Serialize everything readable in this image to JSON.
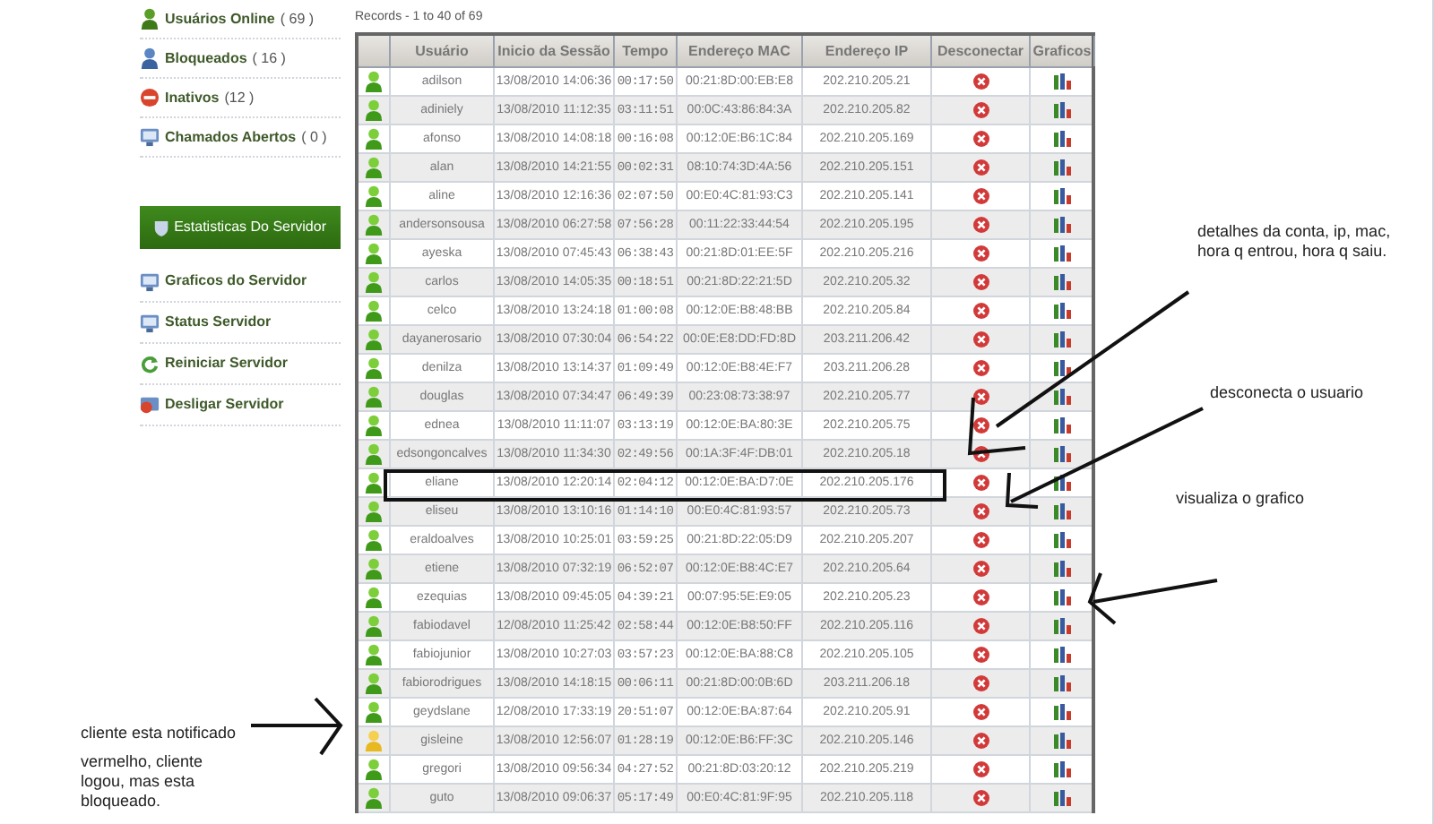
{
  "records": "Records - 1 to 40 of 69",
  "sidebar": {
    "items": [
      {
        "label": "Usuários Online",
        "count": "( 69 )",
        "kind": "online"
      },
      {
        "label": "Bloqueados",
        "count": "( 16 )",
        "kind": "blocked"
      },
      {
        "label": "Inativos",
        "count": "(12 )",
        "kind": "inactive"
      },
      {
        "label": "Chamados Abertos",
        "count": "( 0 )",
        "kind": "tickets"
      }
    ]
  },
  "server_panel": {
    "title": "Estatisticas Do Servidor",
    "items": [
      {
        "label": "Graficos do Servidor",
        "kind": "server"
      },
      {
        "label": "Status Servidor",
        "kind": "server"
      },
      {
        "label": "Reiniciar Servidor",
        "kind": "restart"
      },
      {
        "label": "Desligar Servidor",
        "kind": "shutdown"
      }
    ]
  },
  "table": {
    "columns": [
      "Usuário",
      "Inicio da Sessão",
      "Tempo",
      "Endereço MAC",
      "Endereço IP",
      "Desconectar",
      "Graficos"
    ],
    "rows": [
      {
        "kind": "online",
        "user": "adilson",
        "start": "13/08/2010 14:06:36",
        "time": "00:17:50",
        "mac": "00:21:8D:00:EB:E8",
        "ip": "202.210.205.21"
      },
      {
        "kind": "online",
        "user": "adiniely",
        "start": "13/08/2010 11:12:35",
        "time": "03:11:51",
        "mac": "00:0C:43:86:84:3A",
        "ip": "202.210.205.82"
      },
      {
        "kind": "online",
        "user": "afonso",
        "start": "13/08/2010 14:08:18",
        "time": "00:16:08",
        "mac": "00:12:0E:B6:1C:84",
        "ip": "202.210.205.169"
      },
      {
        "kind": "online",
        "user": "alan",
        "start": "13/08/2010 14:21:55",
        "time": "00:02:31",
        "mac": "08:10:74:3D:4A:56",
        "ip": "202.210.205.151"
      },
      {
        "kind": "online",
        "user": "aline",
        "start": "13/08/2010 12:16:36",
        "time": "02:07:50",
        "mac": "00:E0:4C:81:93:C3",
        "ip": "202.210.205.141"
      },
      {
        "kind": "online",
        "user": "andersonsousa",
        "start": "13/08/2010 06:27:58",
        "time": "07:56:28",
        "mac": "00:11:22:33:44:54",
        "ip": "202.210.205.195"
      },
      {
        "kind": "online",
        "user": "ayeska",
        "start": "13/08/2010 07:45:43",
        "time": "06:38:43",
        "mac": "00:21:8D:01:EE:5F",
        "ip": "202.210.205.216"
      },
      {
        "kind": "online",
        "user": "carlos",
        "start": "13/08/2010 14:05:35",
        "time": "00:18:51",
        "mac": "00:21:8D:22:21:5D",
        "ip": "202.210.205.32"
      },
      {
        "kind": "online",
        "user": "celco",
        "start": "13/08/2010 13:24:18",
        "time": "01:00:08",
        "mac": "00:12:0E:B8:48:BB",
        "ip": "202.210.205.84"
      },
      {
        "kind": "online",
        "user": "dayanerosario",
        "start": "13/08/2010 07:30:04",
        "time": "06:54:22",
        "mac": "00:0E:E8:DD:FD:8D",
        "ip": "203.211.206.42"
      },
      {
        "kind": "online",
        "user": "denilza",
        "start": "13/08/2010 13:14:37",
        "time": "01:09:49",
        "mac": "00:12:0E:B8:4E:F7",
        "ip": "203.211.206.28"
      },
      {
        "kind": "online",
        "user": "douglas",
        "start": "13/08/2010 07:34:47",
        "time": "06:49:39",
        "mac": "00:23:08:73:38:97",
        "ip": "202.210.205.77"
      },
      {
        "kind": "online",
        "user": "ednea",
        "start": "13/08/2010 11:11:07",
        "time": "03:13:19",
        "mac": "00:12:0E:BA:80:3E",
        "ip": "202.210.205.75"
      },
      {
        "kind": "online",
        "user": "edsongoncalves",
        "start": "13/08/2010 11:34:30",
        "time": "02:49:56",
        "mac": "00:1A:3F:4F:DB:01",
        "ip": "202.210.205.18"
      },
      {
        "kind": "online",
        "user": "eliane",
        "start": "13/08/2010 12:20:14",
        "time": "02:04:12",
        "mac": "00:12:0E:BA:D7:0E",
        "ip": "202.210.205.176"
      },
      {
        "kind": "online",
        "user": "eliseu",
        "start": "13/08/2010 13:10:16",
        "time": "01:14:10",
        "mac": "00:E0:4C:81:93:57",
        "ip": "202.210.205.73"
      },
      {
        "kind": "online",
        "user": "eraldoalves",
        "start": "13/08/2010 10:25:01",
        "time": "03:59:25",
        "mac": "00:21:8D:22:05:D9",
        "ip": "202.210.205.207"
      },
      {
        "kind": "online",
        "user": "etiene",
        "start": "13/08/2010 07:32:19",
        "time": "06:52:07",
        "mac": "00:12:0E:B8:4C:E7",
        "ip": "202.210.205.64"
      },
      {
        "kind": "online",
        "user": "ezequias",
        "start": "13/08/2010 09:45:05",
        "time": "04:39:21",
        "mac": "00:07:95:5E:E9:05",
        "ip": "202.210.205.23"
      },
      {
        "kind": "online",
        "user": "fabiodavel",
        "start": "12/08/2010 11:25:42",
        "time": "02:58:44",
        "mac": "00:12:0E:B8:50:FF",
        "ip": "202.210.205.116"
      },
      {
        "kind": "online",
        "user": "fabiojunior",
        "start": "13/08/2010 10:27:03",
        "time": "03:57:23",
        "mac": "00:12:0E:BA:88:C8",
        "ip": "202.210.205.105"
      },
      {
        "kind": "online",
        "user": "fabiorodrigues",
        "start": "13/08/2010 14:18:15",
        "time": "00:06:11",
        "mac": "00:21:8D:00:0B:6D",
        "ip": "203.211.206.18"
      },
      {
        "kind": "online",
        "user": "geydslane",
        "start": "12/08/2010 17:33:19",
        "time": "20:51:07",
        "mac": "00:12:0E:BA:87:64",
        "ip": "202.210.205.91"
      },
      {
        "kind": "notified",
        "user": "gisleine",
        "start": "13/08/2010 12:56:07",
        "time": "01:28:19",
        "mac": "00:12:0E:B6:FF:3C",
        "ip": "202.210.205.146"
      },
      {
        "kind": "online",
        "user": "gregori",
        "start": "13/08/2010 09:56:34",
        "time": "04:27:52",
        "mac": "00:21:8D:03:20:12",
        "ip": "202.210.205.219"
      },
      {
        "kind": "online",
        "user": "guto",
        "start": "13/08/2010 09:06:37",
        "time": "05:17:49",
        "mac": "00:E0:4C:81:9F:95",
        "ip": "202.210.205.118"
      }
    ]
  },
  "notes": [
    "detalhes da conta, ip, mac, hora q entrou, hora q saiu.",
    "desconecta o usuario",
    "visualiza o grafico",
    "cliente esta notificado",
    "vermelho, cliente logou, mas esta bloqueado."
  ]
}
